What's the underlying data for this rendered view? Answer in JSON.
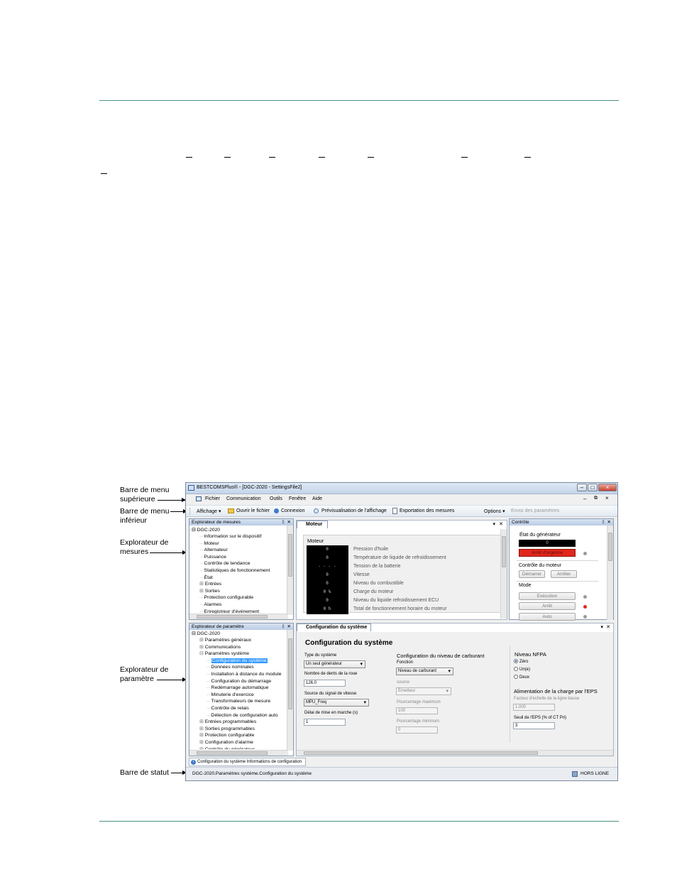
{
  "callouts": {
    "top_menu": [
      "Barre de menu",
      "supérieure"
    ],
    "bottom_menu": [
      "Barre de menu",
      "inférieur"
    ],
    "metering": [
      "Explorateur de",
      "mesures"
    ],
    "settings": [
      "Explorateur de",
      "paramètre"
    ],
    "status": [
      "Barre de statut"
    ]
  },
  "window": {
    "title": "BESTCOMSPlus® - [DGC-2020 - SettingsFile2]",
    "controls": [
      "–",
      "□",
      "×"
    ],
    "mdi_controls": [
      "–",
      "⧉",
      "×"
    ]
  },
  "menubar": {
    "items": [
      "Fichier",
      "Communication",
      "Outils",
      "Fenêtre",
      "Aide"
    ]
  },
  "toolbar": {
    "items": [
      "Affichage ▾",
      "Ouvrir le fichier",
      "Connexion",
      "Prévisualisation de l'affichage",
      "Exportation des mesures"
    ],
    "options": "Options ▾",
    "send": "Envoi des paramètres"
  },
  "metering_explorer": {
    "title": "Explorateur de mesures",
    "root": "DGC-2020",
    "items": [
      "Information sur le dispositif",
      "Moteur",
      "Alternateur",
      "Puissance",
      "Contrôle de tendance",
      "Statistiques de fonctionnement",
      "État",
      "Entrées",
      "Sorties",
      "Protection configurable",
      "Alarmes",
      "Enregistreur d'événement"
    ],
    "expandable": [
      false,
      false,
      false,
      false,
      false,
      false,
      false,
      true,
      true,
      false,
      false,
      false
    ]
  },
  "engine_panel": {
    "tab": "Moteur",
    "group": "Moteur",
    "rows": [
      {
        "value": "0",
        "label": "Pression d'huile"
      },
      {
        "value": "0",
        "label": "Température de liquide de refroidissement"
      },
      {
        "value": "- - - -",
        "label": "Tension de la batterie"
      },
      {
        "value": "0",
        "label": "Vitesse"
      },
      {
        "value": "0",
        "label": "Niveau du combustible"
      },
      {
        "value": "0 %",
        "label": "Charge du moteur"
      },
      {
        "value": "0",
        "label": "Niveau du liquide refroidissement ECU"
      },
      {
        "value": "0 h",
        "label": "Total de fonctionnement horaire du moteur"
      }
    ]
  },
  "control_panel": {
    "title": "Contrôle",
    "gen_state_label": "État du générateur",
    "gen_state_value": "0",
    "gen_state_button": "Arrêt d'urgence",
    "engine_control_label": "Contrôle du moteur",
    "start": "Démarrer",
    "stop": "Arrêter",
    "mode_label": "Mode",
    "modes": [
      "Exécution",
      "Arrêt",
      "Auto"
    ],
    "mode_leds": [
      "#9a9a9a",
      "#e2261c",
      "#9a9a9a"
    ]
  },
  "settings_explorer": {
    "title": "Explorateur de paramètre",
    "root": "DGC-2020",
    "items": [
      {
        "label": "Paramètres généraux",
        "level": 1,
        "exp": "+"
      },
      {
        "label": "Communications",
        "level": 1,
        "exp": "+"
      },
      {
        "label": "Paramètres système",
        "level": 1,
        "exp": "-"
      },
      {
        "label": "Configuration du système",
        "level": 2,
        "exp": "",
        "selected": true
      },
      {
        "label": "Données nominales",
        "level": 2,
        "exp": ""
      },
      {
        "label": "Installation à distance du module",
        "level": 2,
        "exp": ""
      },
      {
        "label": "Configuration du démarrage",
        "level": 2,
        "exp": ""
      },
      {
        "label": "Redémarrage automatique",
        "level": 2,
        "exp": ""
      },
      {
        "label": "Minuterie d'exercice",
        "level": 2,
        "exp": ""
      },
      {
        "label": "Transformateurs de mesure",
        "level": 2,
        "exp": ""
      },
      {
        "label": "Contrôle de relais",
        "level": 2,
        "exp": ""
      },
      {
        "label": "Détection de configuration auto",
        "level": 2,
        "exp": ""
      },
      {
        "label": "Entrées programmables",
        "level": 1,
        "exp": "+"
      },
      {
        "label": "Sorties programmables",
        "level": 1,
        "exp": "+"
      },
      {
        "label": "Protection configurable",
        "level": 1,
        "exp": "+"
      },
      {
        "label": "Configuration d'alarme",
        "level": 1,
        "exp": "+"
      },
      {
        "label": "Contrôle du générateur",
        "level": 1,
        "exp": "+"
      }
    ]
  },
  "sysconfig": {
    "tab": "Configuration du système",
    "heading": "Configuration du système",
    "system_type_label": "Type du système",
    "system_type_value": "Un seul générateur",
    "flywheel_label": "Nombre de dents de la roue",
    "flywheel_value": "126.0",
    "speed_source_label": "Source du signal de vitesse",
    "speed_source_value": "MPU_Freq",
    "crank_delay_label": "Délai de mise en marche (s)",
    "crank_delay_value": "1",
    "fuel_heading": "Configuration du niveau de carburant",
    "function_label": "Fonction",
    "function_value": "Niveau de carburant",
    "source_label": "source",
    "source_value": "Émetteur",
    "max_label": "Pourcentage maximum",
    "max_value": "100",
    "min_label": "Pourcentage minimum",
    "min_value": "0",
    "nfpa_heading": "Niveau NFPA",
    "nfpa_options": [
      "Zéro",
      "Un(e)",
      "Deux"
    ],
    "nfpa_selected": 0,
    "eps_heading": "Alimentation de la charge par l'EPS",
    "eps_scale_label": "Facteur d'échelle de la ligne basse",
    "eps_scale_value": "1.000",
    "eps_threshold_label": "Seuil de l'EPS (% of CT Pri)",
    "eps_threshold_value": "3"
  },
  "bottom_tabs": {
    "info": "Configuration du système Informations de configuration"
  },
  "statusbar": {
    "path": "DGC-2020.Paramètres système.Configuration du système",
    "state": "HORS LIGNE"
  }
}
